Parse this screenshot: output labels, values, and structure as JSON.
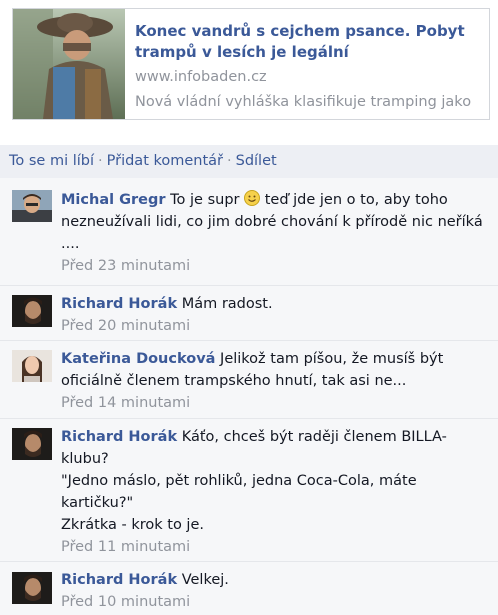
{
  "share": {
    "title": "Konec vandrů s cejchem psance. Pobyt trampů v lesích je legální",
    "domain": "www.infobaden.cz",
    "description": "Nová vládní vyhláška klasifikuje tramping jako"
  },
  "actions": {
    "like": "To se mi líbí",
    "comment": "Přidat komentář",
    "share": "Sdílet",
    "separator": "·"
  },
  "comments": [
    {
      "author": "Michal Gregr",
      "text_before": "To je supr",
      "text_after": "teď jde jen o to, aby toho nezneužívali lidi, co jim dobré chování k přírodě nic neříká ....",
      "time": "Před 23 minutami"
    },
    {
      "author": "Richard Horák",
      "text": "Mám radost.",
      "time": "Před 20 minutami"
    },
    {
      "author": "Kateřina Doucková",
      "text": "Jelikož tam píšou, že musíš být oficiálně členem trampského hnutí, tak asi ne...",
      "time": "Před 14 minutami"
    },
    {
      "author": "Richard Horák",
      "line1": "Káťo, chceš být raději členem BILLA-klubu?",
      "line2": "\"Jedno máslo, pět rohliků, jedna Coca-Cola, máte kartičku?\"",
      "line3": "Zkrátka - krok to je.",
      "time": "Před 11 minutami"
    },
    {
      "author": "Richard Horák",
      "text": "Velkej.",
      "time": "Před 10 minutami"
    }
  ]
}
